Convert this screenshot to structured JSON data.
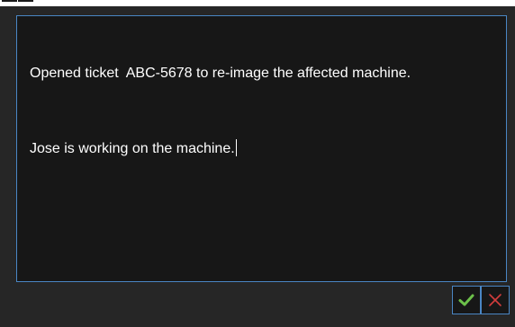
{
  "editor": {
    "paragraphs": [
      "Opened ticket  ABC-5678 to re-image the affected machine.",
      "Jose is working on the machine."
    ]
  },
  "actions": {
    "confirm_icon": "checkmark-icon",
    "cancel_icon": "close-icon"
  },
  "colors": {
    "accent_border": "#4a86c4",
    "editor_background": "#171717",
    "panel_background": "#262626",
    "confirm_color": "#6cc04a",
    "cancel_color": "#d23c3c"
  }
}
